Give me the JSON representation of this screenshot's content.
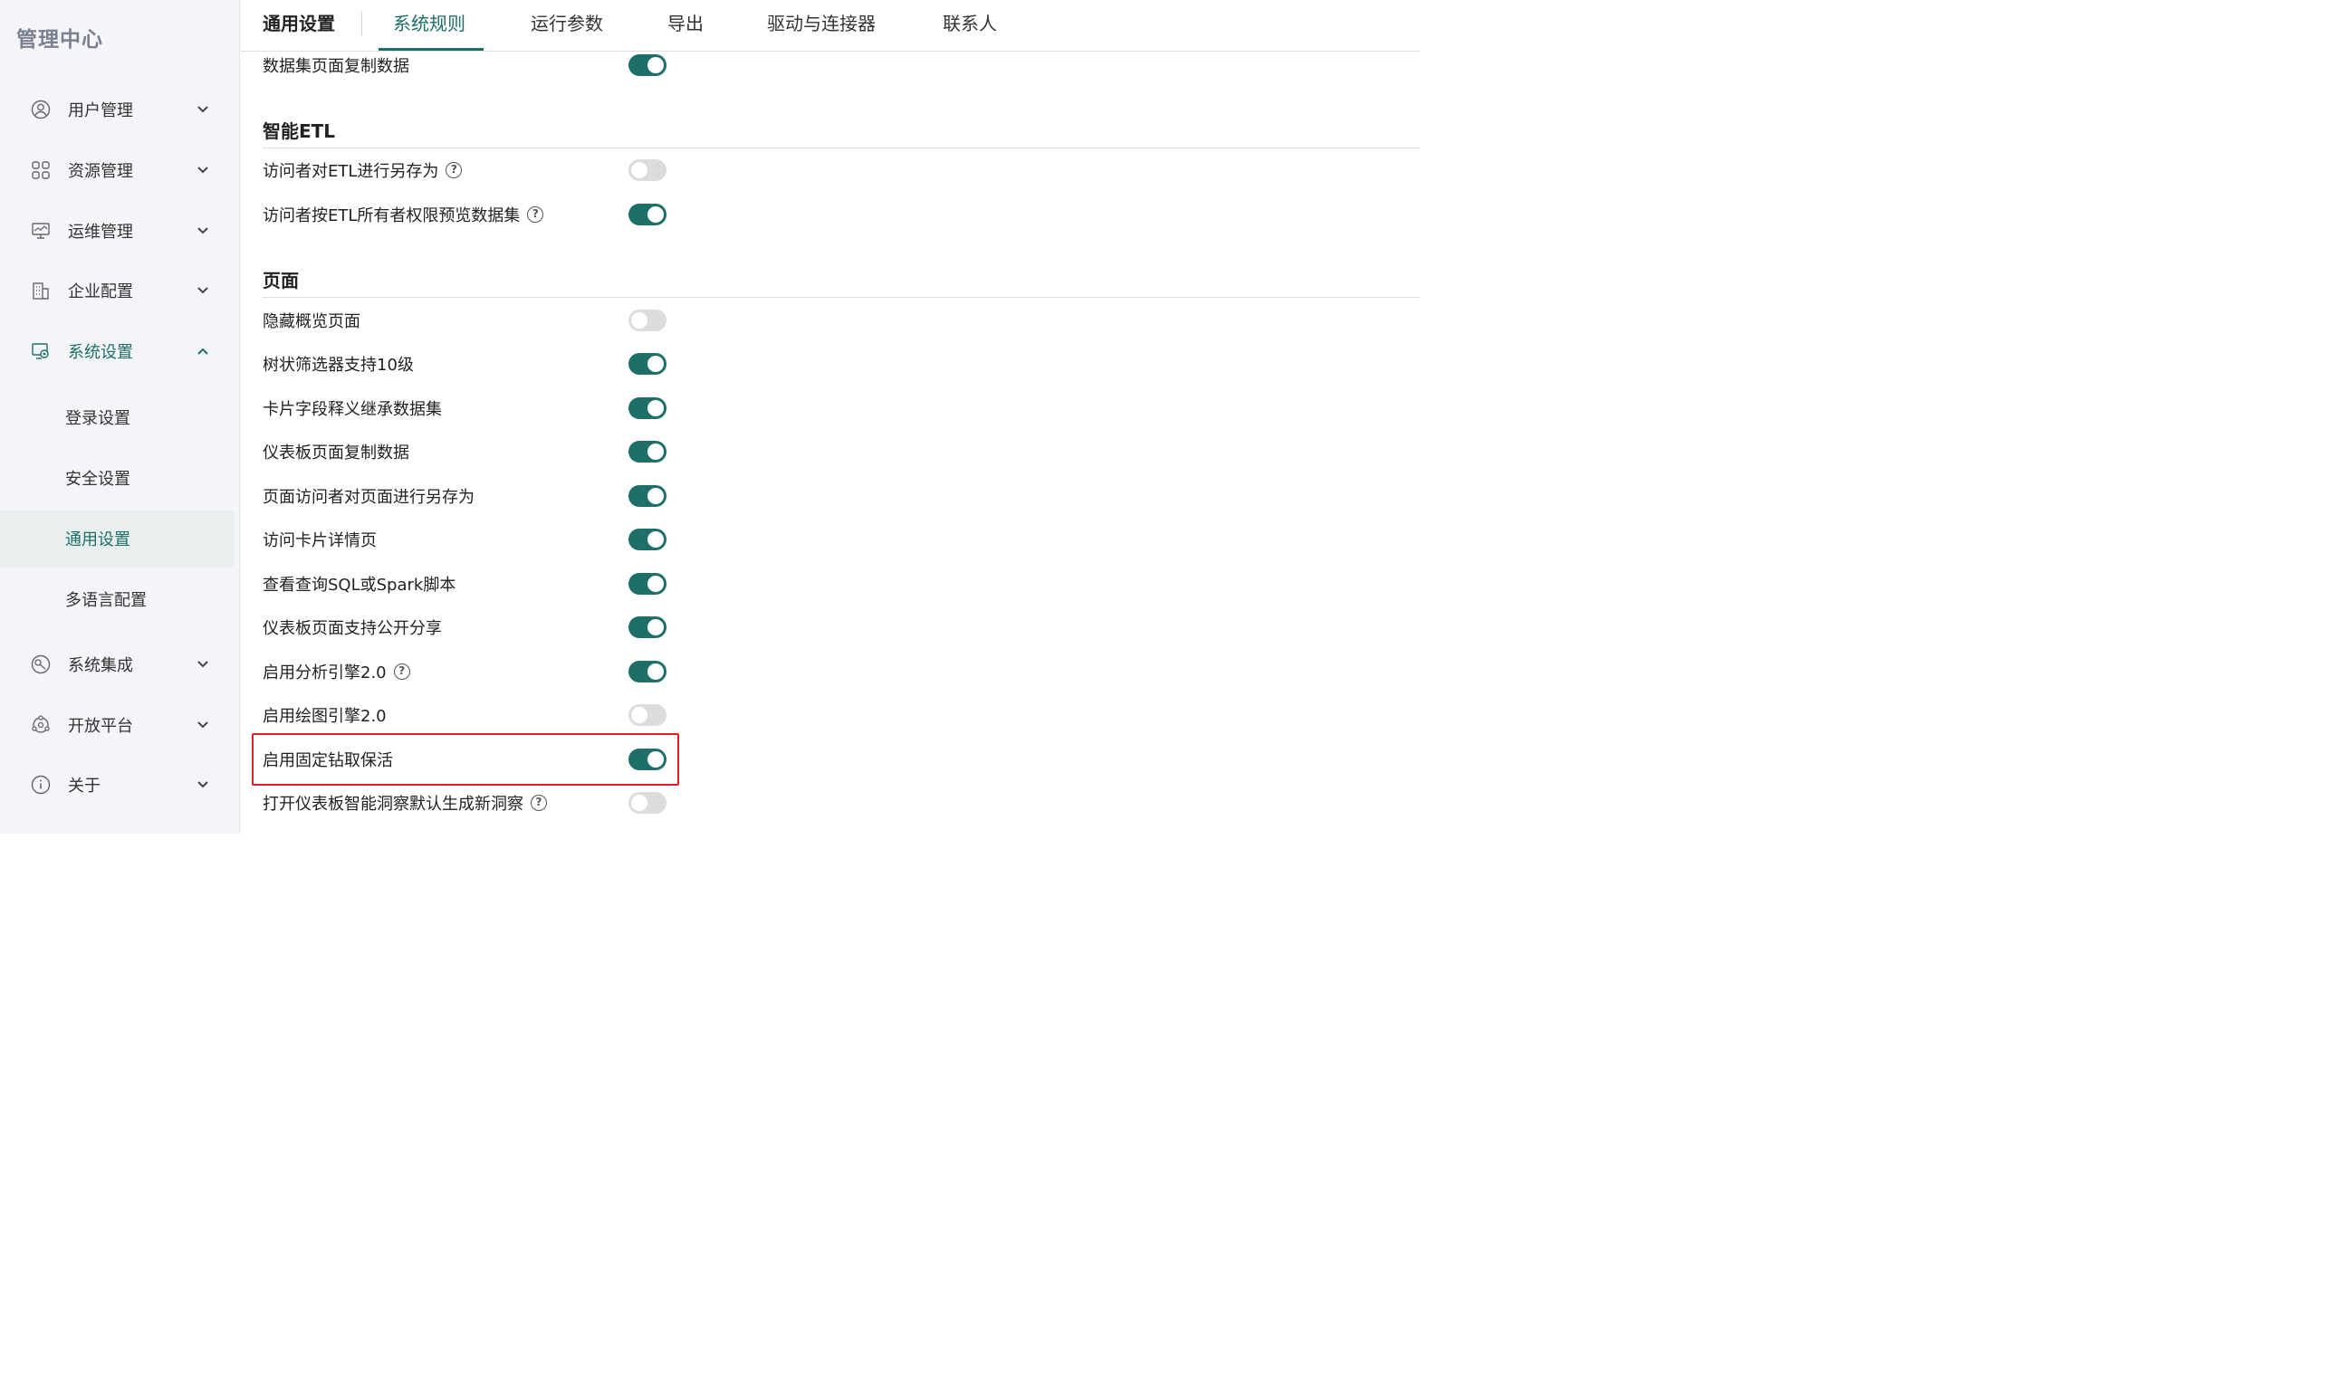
{
  "app": {
    "title": "管理中心"
  },
  "sidebar": {
    "items": [
      {
        "label": "用户管理",
        "icon": "user-circle-icon",
        "expanded": false
      },
      {
        "label": "资源管理",
        "icon": "grid-icon",
        "expanded": false
      },
      {
        "label": "运维管理",
        "icon": "monitor-icon",
        "expanded": false
      },
      {
        "label": "企业配置",
        "icon": "building-icon",
        "expanded": false
      },
      {
        "label": "系统设置",
        "icon": "settings-monitor-icon",
        "expanded": true
      },
      {
        "label": "系统集成",
        "icon": "integration-icon",
        "expanded": false
      },
      {
        "label": "开放平台",
        "icon": "open-platform-icon",
        "expanded": false
      },
      {
        "label": "关于",
        "icon": "info-icon",
        "expanded": false
      }
    ],
    "sub_items": [
      {
        "label": "登录设置",
        "selected": false
      },
      {
        "label": "安全设置",
        "selected": false
      },
      {
        "label": "通用设置",
        "selected": true
      },
      {
        "label": "多语言配置",
        "selected": false
      }
    ]
  },
  "tabs": {
    "page_title": "通用设置",
    "items": [
      {
        "label": "系统规则",
        "active": true
      },
      {
        "label": "运行参数",
        "active": false
      },
      {
        "label": "导出",
        "active": false
      },
      {
        "label": "驱动与连接器",
        "active": false
      },
      {
        "label": "联系人",
        "active": false
      }
    ]
  },
  "content": {
    "top_rows": [
      {
        "label": "数据集页面复制数据",
        "on": true,
        "help": false
      }
    ],
    "sections": [
      {
        "title": "智能ETL",
        "rows": [
          {
            "label": "访问者对ETL进行另存为",
            "on": false,
            "help": true
          },
          {
            "label": "访问者按ETL所有者权限预览数据集",
            "on": true,
            "help": true
          }
        ]
      },
      {
        "title": "页面",
        "rows": [
          {
            "label": "隐藏概览页面",
            "on": false,
            "help": false
          },
          {
            "label": "树状筛选器支持10级",
            "on": true,
            "help": false
          },
          {
            "label": "卡片字段释义继承数据集",
            "on": true,
            "help": false
          },
          {
            "label": "仪表板页面复制数据",
            "on": true,
            "help": false
          },
          {
            "label": "页面访问者对页面进行另存为",
            "on": true,
            "help": false
          },
          {
            "label": "访问卡片详情页",
            "on": true,
            "help": false
          },
          {
            "label": "查看查询SQL或Spark脚本",
            "on": true,
            "help": false
          },
          {
            "label": "仪表板页面支持公开分享",
            "on": true,
            "help": false
          },
          {
            "label": "启用分析引擎2.0",
            "on": true,
            "help": true
          },
          {
            "label": "启用绘图引擎2.0",
            "on": false,
            "help": false
          },
          {
            "label": "启用固定钻取保活",
            "on": true,
            "help": false,
            "highlighted": true
          },
          {
            "label": "打开仪表板智能洞察默认生成新洞察",
            "on": false,
            "help": true
          }
        ]
      }
    ]
  },
  "colors": {
    "accent": "#1d6f67",
    "toggle_off": "#dcdcdc",
    "highlight_box": "#e02020",
    "sidebar_bg": "#f4f5f9",
    "selected_bg": "#e8efee"
  }
}
